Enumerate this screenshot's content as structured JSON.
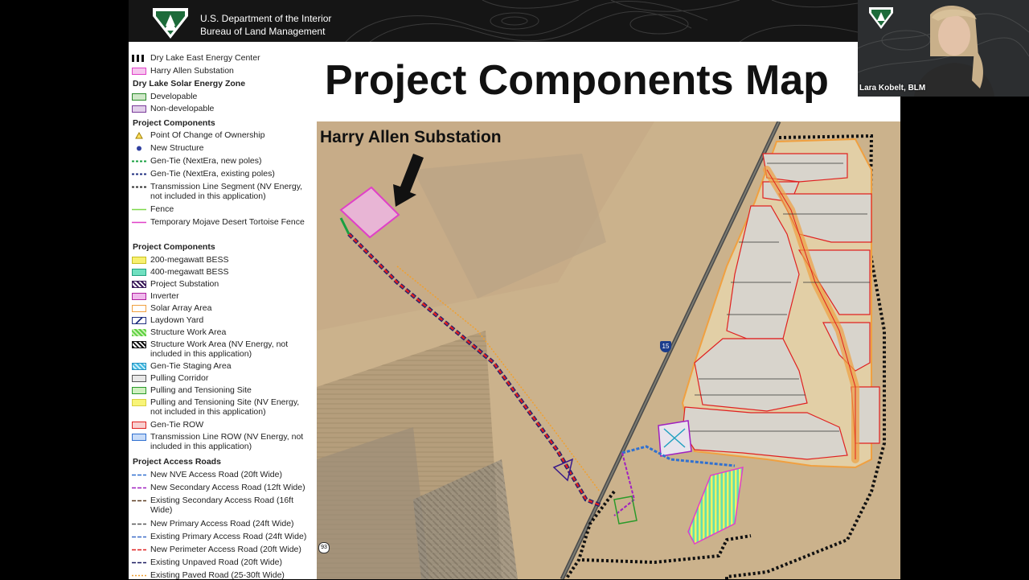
{
  "header": {
    "agency_line1": "U.S. Department of the Interior",
    "agency_line2": "Bureau of Land Management"
  },
  "slide": {
    "title": "Project Components Map"
  },
  "map": {
    "callout_label": "Harry Allen Substation",
    "highway_15": "15",
    "highway_93": "93"
  },
  "legend": {
    "group1": [
      {
        "label": "Dry Lake East Energy Center"
      },
      {
        "label": "Harry Allen Substation"
      }
    ],
    "zone_heading": "Dry Lake Solar Energy Zone",
    "zone_items": [
      {
        "label": "Developable"
      },
      {
        "label": "Non-developable"
      }
    ],
    "components_heading_1": "Project Components",
    "components_1": [
      {
        "label": "Point Of Change of Ownership"
      },
      {
        "label": "New Structure"
      },
      {
        "label": "Gen-Tie (NextEra, new poles)"
      },
      {
        "label": "Gen-Tie (NextEra, existing poles)"
      },
      {
        "label": "Transmission Line Segment (NV Energy, not included in this application)"
      },
      {
        "label": "Fence"
      },
      {
        "label": "Temporary Mojave Desert Tortoise Fence"
      }
    ],
    "components_heading_2": "Project Components",
    "components_2": [
      {
        "label": "200-megawatt BESS"
      },
      {
        "label": "400-megawatt BESS"
      },
      {
        "label": "Project Substation"
      },
      {
        "label": "Inverter"
      },
      {
        "label": "Solar Array Area"
      },
      {
        "label": "Laydown Yard"
      },
      {
        "label": "Structure Work Area"
      },
      {
        "label": "Structure Work Area (NV Energy, not included in this application)"
      },
      {
        "label": "Gen-Tie Staging Area"
      },
      {
        "label": "Pulling Corridor"
      },
      {
        "label": "Pulling and Tensioning Site"
      },
      {
        "label": "Pulling and Tensioning Site (NV Energy, not included in this application)"
      },
      {
        "label": "Gen-Tie ROW"
      },
      {
        "label": "Transmission Line ROW (NV Energy, not included in this application)"
      }
    ],
    "roads_heading": "Project Access Roads",
    "roads": [
      {
        "label": "New NVE Access Road (20ft Wide)"
      },
      {
        "label": "New Secondary Access Road (12ft Wide)"
      },
      {
        "label": "Existing Secondary Access Road (16ft Wide)"
      },
      {
        "label": "New Primary Access Road (24ft Wide)"
      },
      {
        "label": "Existing Primary Access Road (24ft Wide)"
      },
      {
        "label": "New Perimeter Access Road (20ft Wide)"
      },
      {
        "label": "Existing Unpaved Road (20ft Wide)"
      },
      {
        "label": "Existing Paved Road (25-30ft Wide)"
      }
    ]
  },
  "webcam": {
    "participant_name": "Lara Kobelt, BLM"
  },
  "colors": {
    "substation": "#e040c8",
    "solar_area_fill": "#ddd5cd",
    "solar_area_border": "#f0a040",
    "gen_tie_row": "#e02020",
    "boundary": "#111111",
    "highway": "#444444"
  }
}
